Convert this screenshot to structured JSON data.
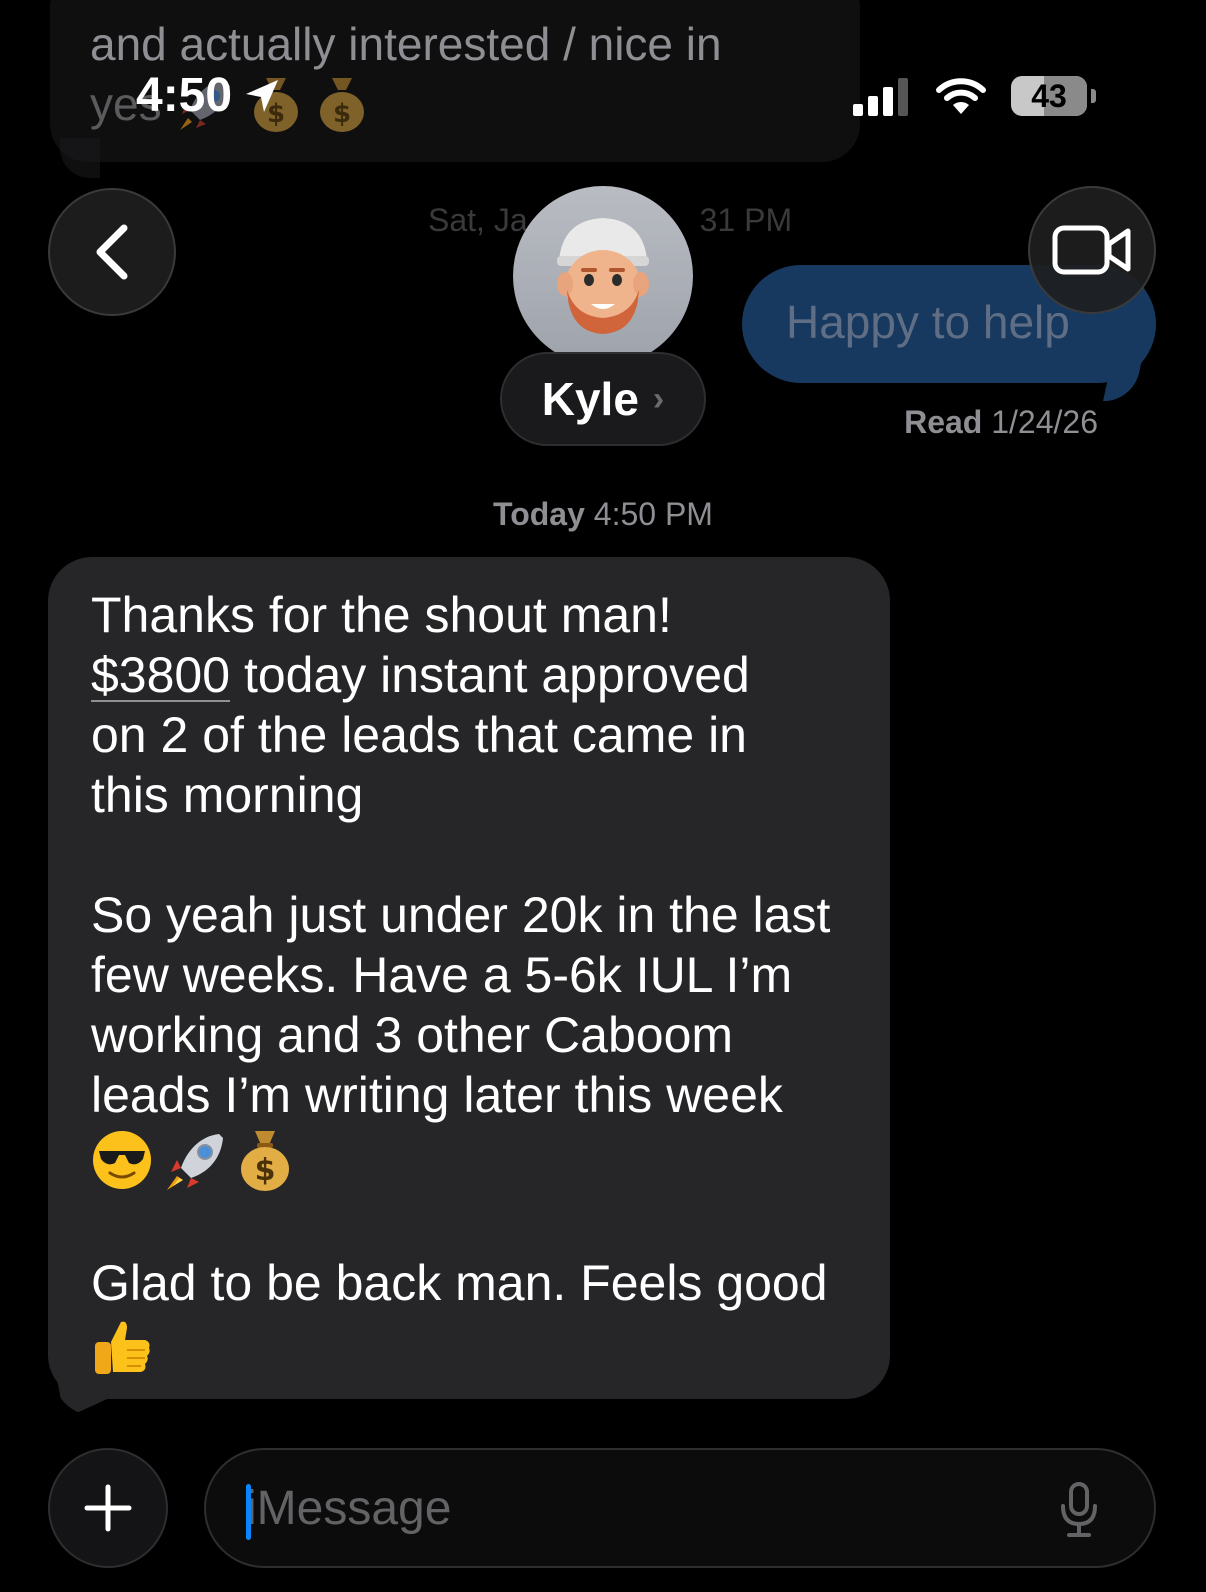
{
  "status_bar": {
    "time": "4:50",
    "battery": "43"
  },
  "previous_message": {
    "line1": "and actually interested / nice in",
    "line2": "yes"
  },
  "header": {
    "contact_name": "Kyle",
    "faded_timestamp": "Sat, Ja",
    "faded_timestamp_end": "31 PM"
  },
  "sent_message": {
    "text": "Happy to help",
    "read_label": "Read",
    "read_date": "1/24/26"
  },
  "timestamp": {
    "day": "Today",
    "time": "4:50 PM"
  },
  "received_message": {
    "p1_line1": "Thanks for the shout man!",
    "p1_amount": "$3800",
    "p1_line2_rest": " today instant approved",
    "p1_line3": "on 2 of the leads that came in",
    "p1_line4": "this morning",
    "p2_line1": "So yeah just under 20k in the last",
    "p2_line2": "few weeks. Have a 5-6k IUL I’m",
    "p2_line3": "working and 3 other Caboom",
    "p2_line4": "leads I’m writing later this week",
    "p3_line1": "Glad to be back man. Feels good"
  },
  "composer": {
    "placeholder": "iMessage"
  },
  "icons": {
    "back": "chevron-left-icon",
    "video": "video-camera-icon",
    "plus": "plus-icon",
    "mic": "microphone-icon",
    "location": "location-arrow-icon",
    "signal": "cellular-signal-icon",
    "wifi": "wifi-icon",
    "battery": "battery-icon"
  },
  "colors": {
    "background": "#000000",
    "received_bubble": "#262628",
    "sent_bubble": "#17395f",
    "accent": "#0a84ff",
    "secondary_text": "#8e8e93"
  }
}
